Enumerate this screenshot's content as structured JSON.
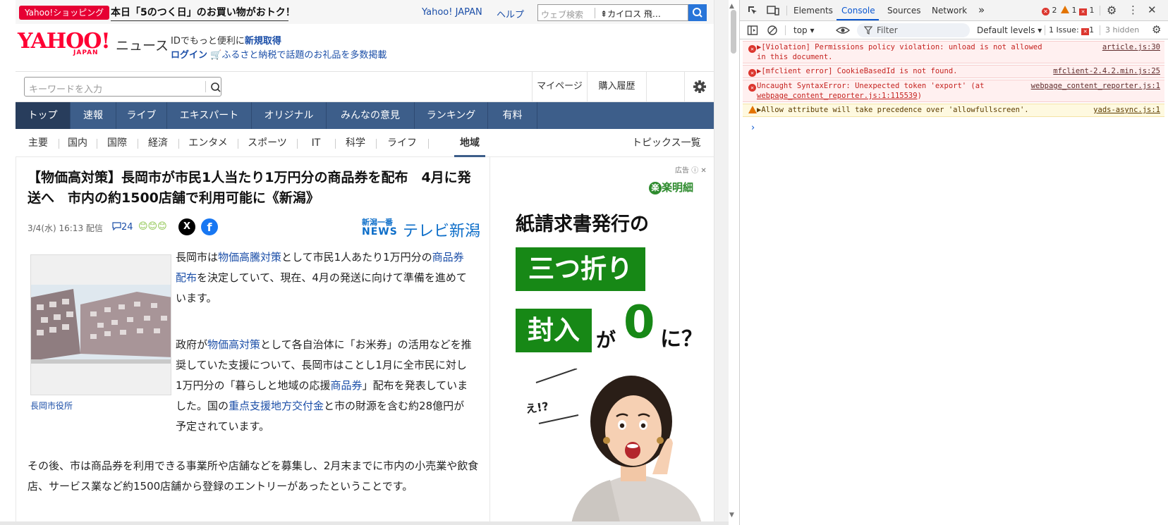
{
  "page": {
    "promo": {
      "badge": "Yahoo!ショッピング",
      "text": "本日「5のつく日」のお買い物がおトク！"
    },
    "top_links": {
      "yahoo_japan": "Yahoo! JAPAN",
      "help": "ヘルプ"
    },
    "web_search": {
      "placeholder": "ウェブ検索",
      "suggestion": "カイロス 飛…"
    },
    "logo": {
      "yahoo": "YAHOO!",
      "japan": "JAPAN",
      "news": "ニュース"
    },
    "id_promo": {
      "line1_prefix": "IDでもっと便利に",
      "line1_link": "新規取得",
      "login": "ログイン",
      "line2_link": "ふるさと納税で話題のお礼品を多数掲載"
    },
    "keyword_search": {
      "placeholder": "キーワードを入力"
    },
    "header_buttons": {
      "mypage": "マイページ",
      "history": "購入履歴"
    },
    "main_nav": [
      "トップ",
      "速報",
      "ライブ",
      "エキスパート",
      "オリジナル",
      "みんなの意見",
      "ランキング",
      "有料"
    ],
    "sub_nav": [
      "主要",
      "国内",
      "国際",
      "経済",
      "エンタメ",
      "スポーツ",
      "IT",
      "科学",
      "ライフ",
      "地域"
    ],
    "topics_link": "トピックス一覧",
    "article": {
      "headline": "【物価高対策】長岡市が市民1人当たり1万円分の商品券を配布　4月に発送へ　市内の約1500店舗で利用可能に《新潟》",
      "datetime": "3/4(水) 16:13 配信",
      "comment_count": "24",
      "share_x": "X",
      "share_fb": "f",
      "source": {
        "small": "新潟一番",
        "news": "NEWS",
        "name": "テレビ新潟"
      },
      "photo_caption": "長岡市役所",
      "p1": [
        {
          "t": "長岡市は"
        },
        {
          "t": "物価高騰対策",
          "link": true
        },
        {
          "t": "として市民1人あたり1万円分の"
        },
        {
          "t": "商品券配布",
          "link": true
        },
        {
          "t": "を決定していて、現在、4月の発送に向けて準備を進めています。"
        }
      ],
      "p2": [
        {
          "t": "政府が"
        },
        {
          "t": "物価高対策",
          "link": true
        },
        {
          "t": "として各自治体に「お米券」の活用などを推奨していた支援について、長岡市はことし1月に全市民に対し1万円分の「暮らしと地域の応援"
        },
        {
          "t": "商品券",
          "link": true
        },
        {
          "t": "」配布を発表していました。国の"
        },
        {
          "t": "重点支援地方交付金",
          "link": true
        },
        {
          "t": "と市の財源を含む約28億円が予定されています。"
        }
      ],
      "p3": "その後、市は商品券を利用できる事業所や店舗などを募集し、2月末までに市内の小売業や飲食店、サービス業など約1500店舗から登録のエントリーがあったということです。"
    },
    "ad": {
      "label": "広告",
      "brand": "楽明細",
      "line1": "紙請求書発行の",
      "box1": "三つ折り",
      "box2": "封入",
      "ga": "が",
      "zero": "0",
      "ni": "に？",
      "exclaim": "え!?"
    }
  },
  "devtools": {
    "tabs": [
      "Elements",
      "Console",
      "Sources",
      "Network"
    ],
    "active_tab": "Console",
    "more_tabs": "»",
    "counts": {
      "errors": "2",
      "warnings": "1",
      "issues": "1"
    },
    "context": "top ▾",
    "filter_placeholder": "Filter",
    "levels": "Default levels ▾",
    "issue_label": "1 Issue:",
    "issue_count": "1",
    "hidden": "3 hidden",
    "messages": [
      {
        "level": "error",
        "text": "▶[Violation] Permissions policy violation: unload is not allowed in this document.",
        "source": "article.js:30"
      },
      {
        "level": "error",
        "text": "▶[mfclient error] CookieBasedId is not found.",
        "source": "mfclient-2.4.2.min.js:25"
      },
      {
        "level": "error",
        "text": "Uncaught SyntaxError: Unexpected token 'export' (at ",
        "link": "webpage_content_reporter.js:1:115539",
        "tail": ")",
        "source": "webpage_content_reporter.js:1"
      },
      {
        "level": "warning",
        "text": "▶Allow attribute will take precedence over 'allowfullscreen'.",
        "source": "yads-async.js:1"
      }
    ],
    "prompt": "›"
  },
  "colors": {
    "yahoo_red": "#ff0033",
    "nav_blue": "#3d5e8a",
    "link_blue": "#1c4fa8",
    "ad_green": "#178816",
    "devtools_accent": "#0b57d0",
    "error_bg": "#fff0f0",
    "warning_bg": "#fef9e0"
  }
}
